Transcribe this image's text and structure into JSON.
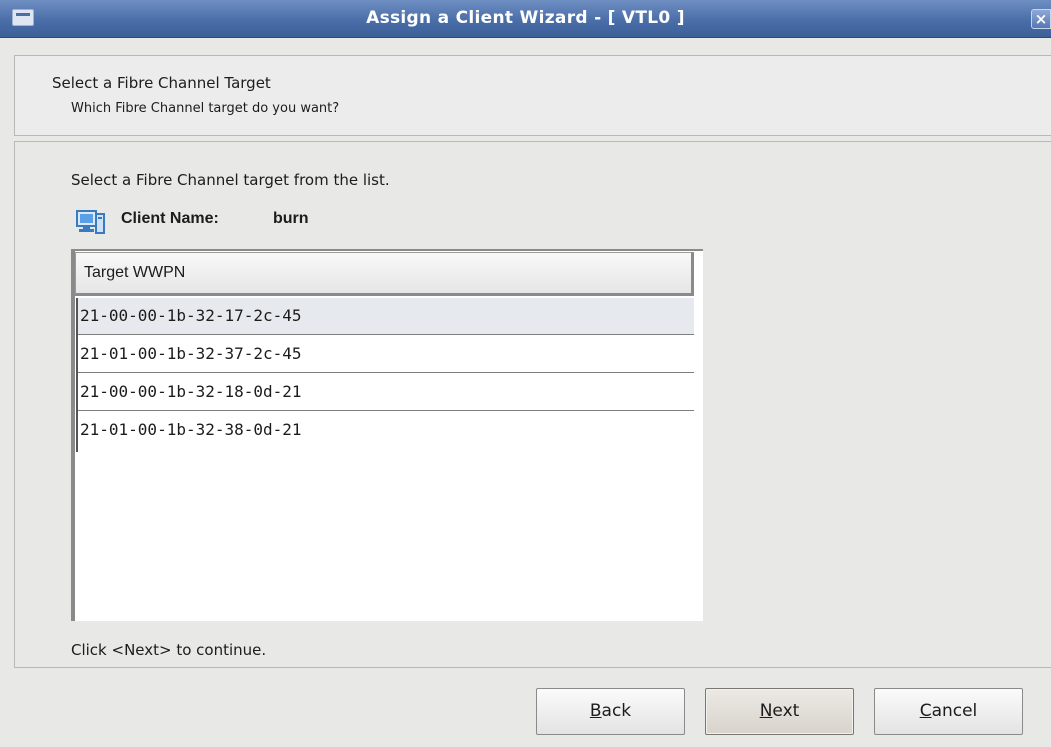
{
  "window": {
    "title": "Assign a Client Wizard - [ VTL0 ]",
    "close_label": "×"
  },
  "header": {
    "title": "Select a Fibre Channel Target",
    "subtitle": "Which Fibre Channel target do you want?"
  },
  "content": {
    "instruction": "Select a Fibre Channel target from the list.",
    "client_label": "Client Name:",
    "client_name": "burn",
    "client_icon": "computer-icon",
    "table": {
      "column_header": "Target WWPN",
      "selected_index": 0,
      "rows": [
        "21-00-00-1b-32-17-2c-45",
        "21-01-00-1b-32-37-2c-45",
        "21-00-00-1b-32-18-0d-21",
        "21-01-00-1b-32-38-0d-21"
      ]
    },
    "footer": "Click <Next> to continue."
  },
  "buttons": {
    "back": {
      "mnemonic": "B",
      "rest": "ack"
    },
    "next": {
      "mnemonic": "N",
      "rest": "ext"
    },
    "cancel": {
      "mnemonic": "C",
      "rest": "ancel"
    }
  },
  "colors": {
    "titlebar": "#4a6ea8",
    "background": "#e8e8e7",
    "selected_row": "#e6eaee"
  }
}
